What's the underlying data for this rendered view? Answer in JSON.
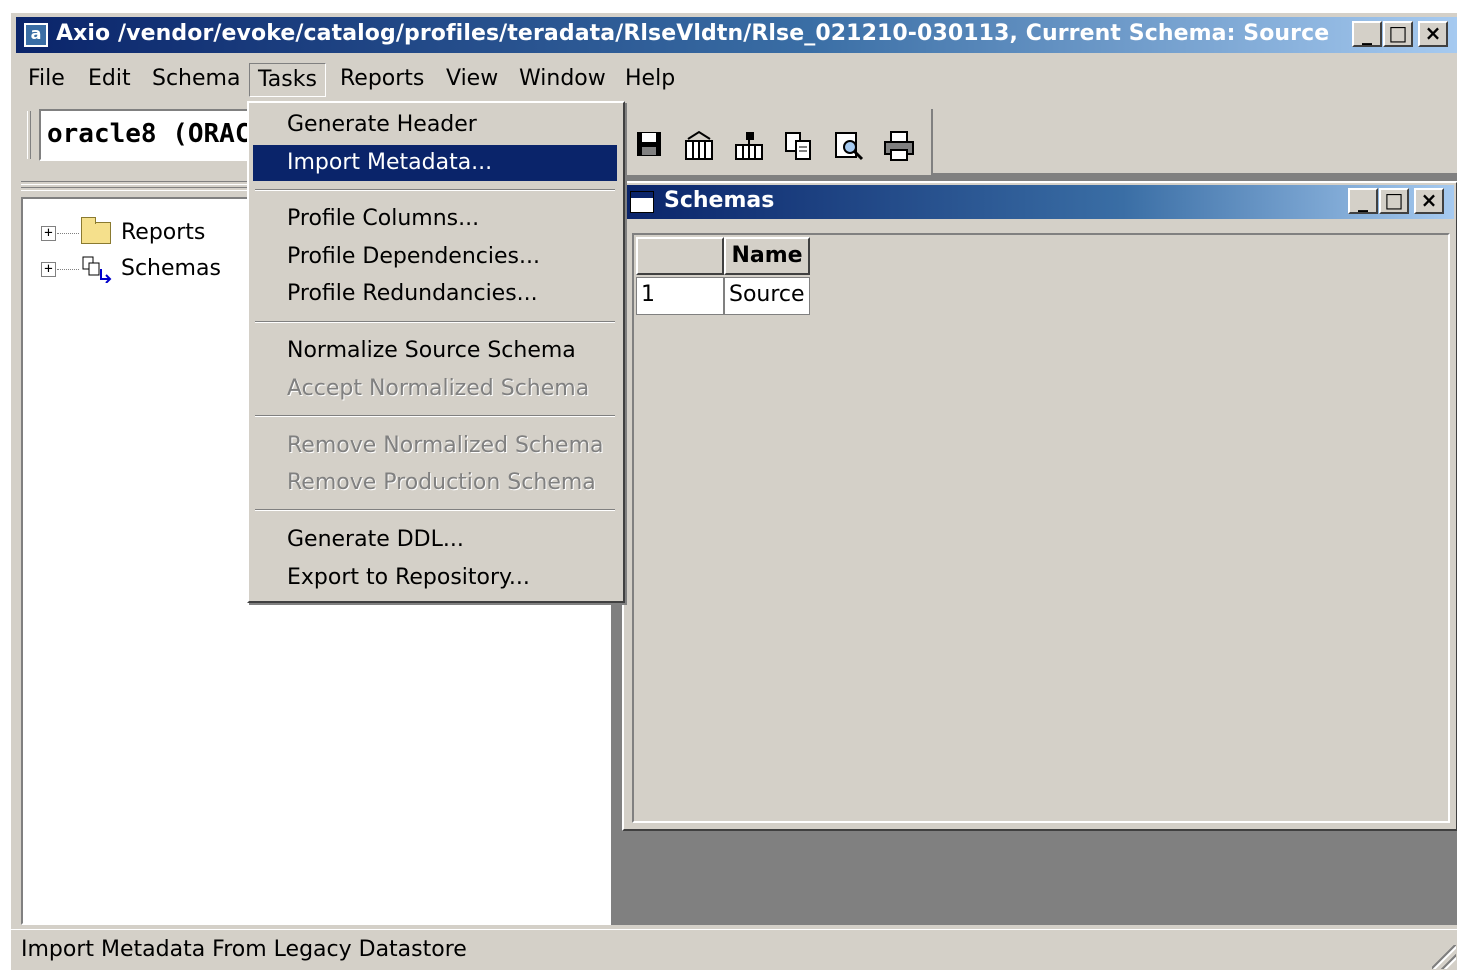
{
  "window": {
    "title": "Axio /vendor/evoke/catalog/profiles/teradata/RlseVldtn/Rlse_021210-030113, Current Schema: Source",
    "app_icon": "a",
    "minimize": "_",
    "maximize": "□",
    "close": "×"
  },
  "menubar": {
    "items": [
      "File",
      "Edit",
      "Schema",
      "Tasks",
      "Reports",
      "View",
      "Window",
      "Help"
    ],
    "active": "Tasks"
  },
  "combo": {
    "value": "oracle8 (ORACLE)"
  },
  "tree": {
    "items": [
      {
        "label": "Reports",
        "icon": "folder-icon",
        "expander": "+"
      },
      {
        "label": "Schemas",
        "icon": "schema-icon",
        "expander": "+"
      }
    ]
  },
  "toolbar": {
    "icons": [
      "save-icon",
      "columns-icon",
      "dependencies-icon",
      "copy-icon",
      "inspect-icon",
      "print-icon"
    ]
  },
  "tasks_menu": {
    "groups": [
      [
        {
          "label": "Generate Header",
          "enabled": true
        },
        {
          "label": "Import Metadata...",
          "enabled": true,
          "selected": true
        }
      ],
      [
        {
          "label": "Profile Columns...",
          "enabled": true
        },
        {
          "label": "Profile Dependencies...",
          "enabled": true
        },
        {
          "label": "Profile Redundancies...",
          "enabled": true
        }
      ],
      [
        {
          "label": "Normalize Source Schema",
          "enabled": true
        },
        {
          "label": "Accept Normalized Schema",
          "enabled": false
        }
      ],
      [
        {
          "label": "Remove Normalized Schema",
          "enabled": false
        },
        {
          "label": "Remove Production Schema",
          "enabled": false
        }
      ],
      [
        {
          "label": "Generate DDL...",
          "enabled": true
        },
        {
          "label": "Export to Repository...",
          "enabled": true
        }
      ]
    ]
  },
  "schemas_window": {
    "title": "Schemas",
    "minimize": "_",
    "maximize": "□",
    "close": "×",
    "grid": {
      "columns": [
        "Name"
      ],
      "rows": [
        {
          "index": "1",
          "name": "Source"
        }
      ]
    }
  },
  "statusbar": {
    "text": "Import Metadata From Legacy Datastore"
  },
  "colors": {
    "title_gradient_start": "#0a246a",
    "title_gradient_end": "#a6caf0",
    "face": "#d4d0c8",
    "selection": "#0a246a"
  }
}
